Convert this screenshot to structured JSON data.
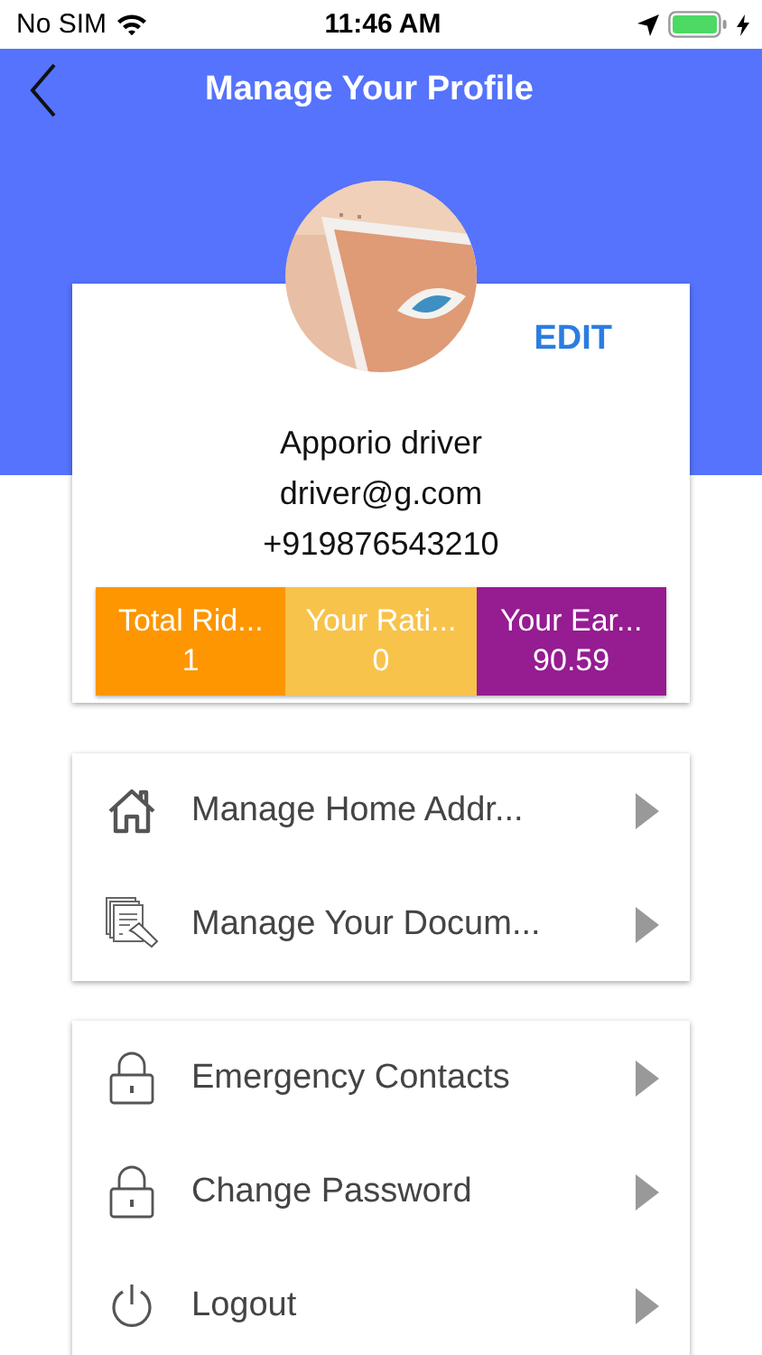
{
  "status_bar": {
    "carrier": "No SIM",
    "time": "11:46 AM"
  },
  "header": {
    "title": "Manage Your Profile"
  },
  "profile": {
    "edit": "EDIT",
    "name": "Apporio driver",
    "email": "driver@g.com",
    "phone": "+919876543210",
    "stats": [
      {
        "label": "Total Rid...",
        "value": "1",
        "color": "#fd9600"
      },
      {
        "label": "Your Rati...",
        "value": "0",
        "color": "#f8c34b"
      },
      {
        "label": "Your Ear...",
        "value": "90.59",
        "color": "#951c91"
      }
    ]
  },
  "menu_groups": [
    {
      "items": [
        {
          "kind": "home",
          "label": "Manage Home Addr..."
        },
        {
          "kind": "documents",
          "label": "Manage Your Docum..."
        }
      ]
    },
    {
      "items": [
        {
          "kind": "lock",
          "label": "Emergency Contacts"
        },
        {
          "kind": "lock",
          "label": "Change Password"
        },
        {
          "kind": "logout",
          "label": "Logout"
        }
      ]
    }
  ]
}
